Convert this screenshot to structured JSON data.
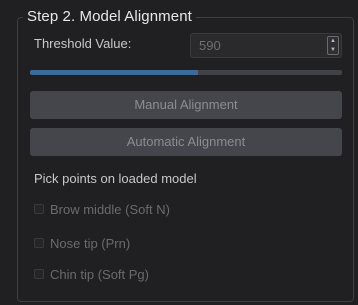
{
  "group": {
    "title": "Step 2. Model Alignment"
  },
  "threshold": {
    "label": "Threshold Value:",
    "value": "590"
  },
  "progress": {
    "fraction": 0.54
  },
  "buttons": {
    "manual": "Manual Alignment",
    "automatic": "Automatic Alignment"
  },
  "picking": {
    "instruction": "Pick points on loaded model",
    "points": [
      {
        "label": "Brow middle (Soft N)",
        "checked": false
      },
      {
        "label": "Nose tip (Prn)",
        "checked": false
      },
      {
        "label": "Chin tip (Soft Pg)",
        "checked": false
      }
    ]
  },
  "colors": {
    "accent": "#3c6b9a",
    "button_bg": "#45464c",
    "panel_bg": "#202022"
  },
  "icons": {
    "spin_up": "▲",
    "spin_down": "▼"
  }
}
